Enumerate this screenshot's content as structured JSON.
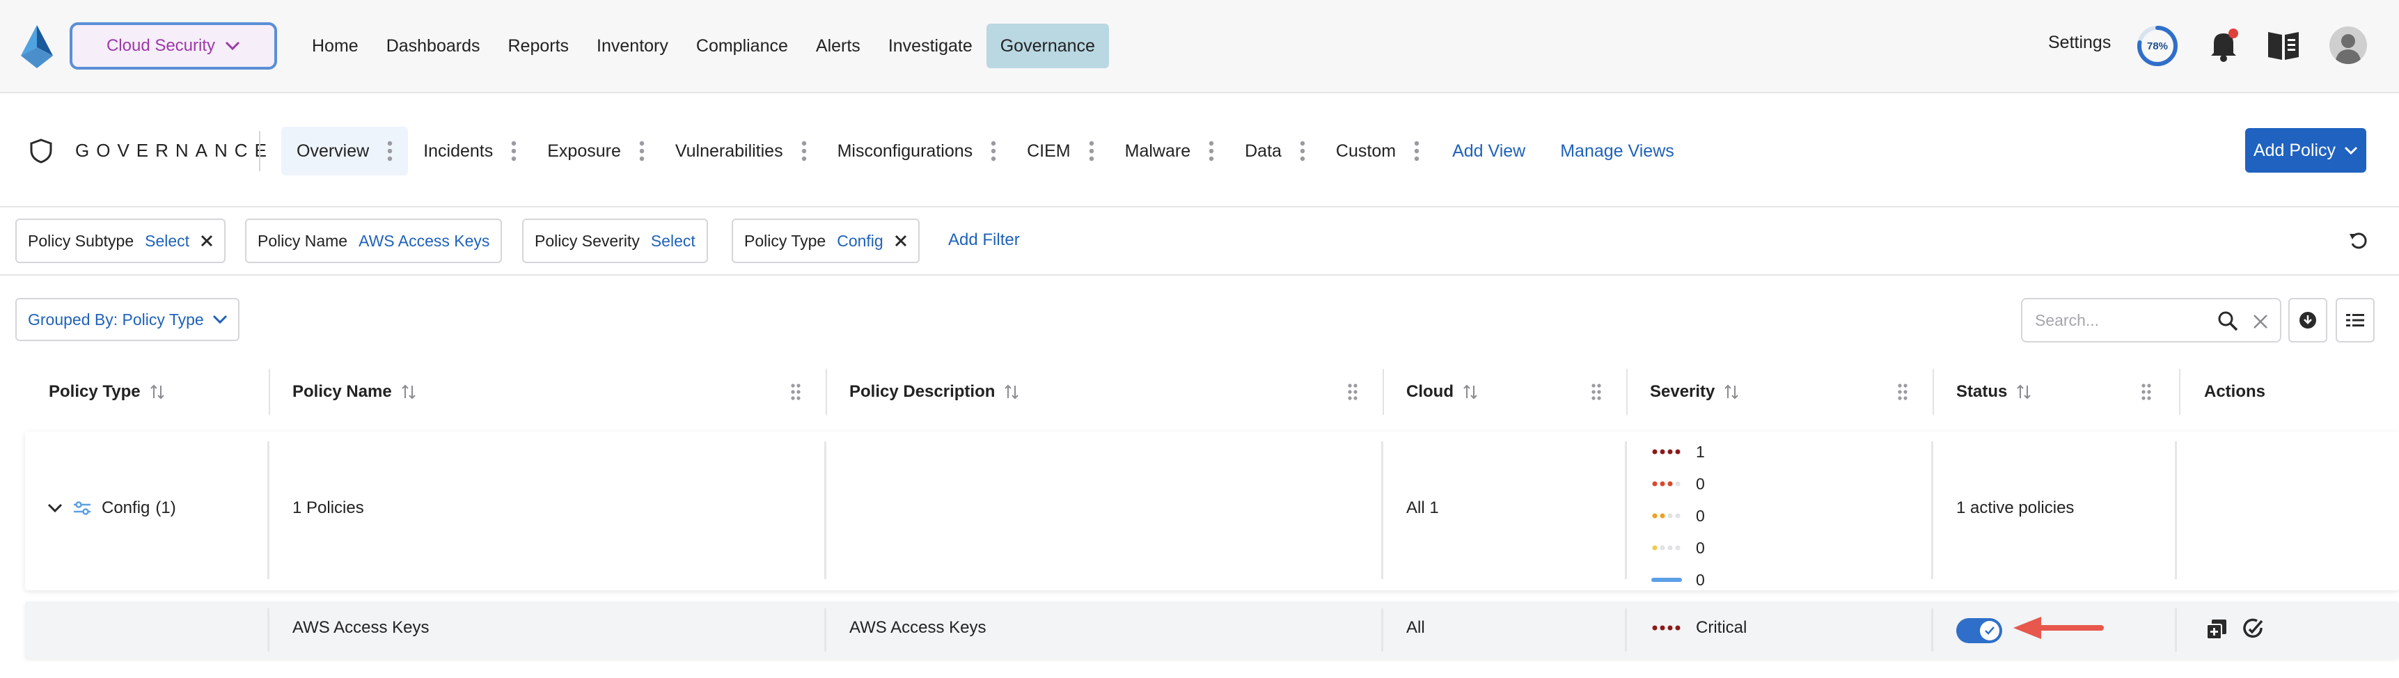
{
  "topnav": {
    "product": "Cloud Security",
    "items": [
      "Home",
      "Dashboards",
      "Reports",
      "Inventory",
      "Compliance",
      "Alerts",
      "Investigate",
      "Governance"
    ],
    "active": "Governance",
    "settings": "Settings",
    "progress_label": "78%",
    "progress_value": 0.78,
    "notification_dot_color": "#e0413a",
    "icons": [
      "prisma-logo-icon",
      "chevron-down-icon",
      "bell-icon",
      "book-icon",
      "avatar"
    ]
  },
  "governance": {
    "title": "GOVERNANCE",
    "tabs": [
      "Overview",
      "Incidents",
      "Exposure",
      "Vulnerabilities",
      "Misconfigurations",
      "CIEM",
      "Malware",
      "Data",
      "Custom"
    ],
    "active_tab": "Overview",
    "add_view": "Add View",
    "manage_views": "Manage Views",
    "add_policy": "Add Policy"
  },
  "filters": {
    "chips": [
      {
        "key": "Policy Subtype",
        "value": "Select",
        "removable": true
      },
      {
        "key": "Policy Name",
        "value": "AWS Access Keys",
        "removable": false
      },
      {
        "key": "Policy Severity",
        "value": "Select",
        "removable": false
      },
      {
        "key": "Policy Type",
        "value": "Config",
        "removable": true
      }
    ],
    "add_filter": "Add Filter"
  },
  "toolbar": {
    "group_by": "Grouped By: Policy Type",
    "search_placeholder": "Search..."
  },
  "table": {
    "columns": [
      "Policy Type",
      "Policy Name",
      "Policy Description",
      "Cloud",
      "Severity",
      "Status",
      "Actions"
    ],
    "group": {
      "type": "Config",
      "count": "(1)",
      "policies": "1 Policies",
      "description": "",
      "cloud": "All 1",
      "severity_counts": [
        {
          "level": "critical",
          "count": "1",
          "color": "#8b1a1a"
        },
        {
          "level": "high",
          "count": "0",
          "color": "#d9482b"
        },
        {
          "level": "medium",
          "count": "0",
          "color": "#f0a020"
        },
        {
          "level": "low",
          "count": "0",
          "color": "#f2c94c"
        },
        {
          "level": "informational",
          "count": "0",
          "color": "#5b9fe6"
        }
      ],
      "status": "1 active policies"
    },
    "rows": [
      {
        "type": "",
        "name": "AWS Access Keys",
        "description": "AWS Access Keys",
        "cloud": "All",
        "severity": "Critical",
        "status_enabled": true
      }
    ]
  },
  "annotation": {
    "arrow_color": "#e8574c"
  },
  "colors": {
    "accent": "#1f62c0",
    "link": "#1f62b9",
    "active_nav": "#b9d8e2"
  }
}
